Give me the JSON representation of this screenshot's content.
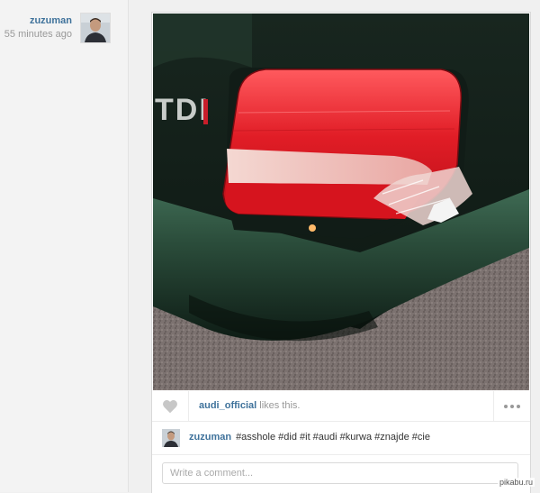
{
  "author": {
    "username": "zuzuman",
    "time": "55 minutes ago"
  },
  "likes": {
    "liker": "audi_official",
    "suffix": " likes this."
  },
  "caption": {
    "username": "zuzuman",
    "text": "#asshole #did #it #audi #kurwa #znajde #cie"
  },
  "comment": {
    "placeholder": "Write a comment..."
  },
  "photo": {
    "badge_text": "TDI"
  },
  "watermark": "pikabu.ru",
  "colors": {
    "link": "#3f729b",
    "muted": "#999999",
    "tail_light": "#e8202a",
    "car_paint": "#1f4a35"
  }
}
